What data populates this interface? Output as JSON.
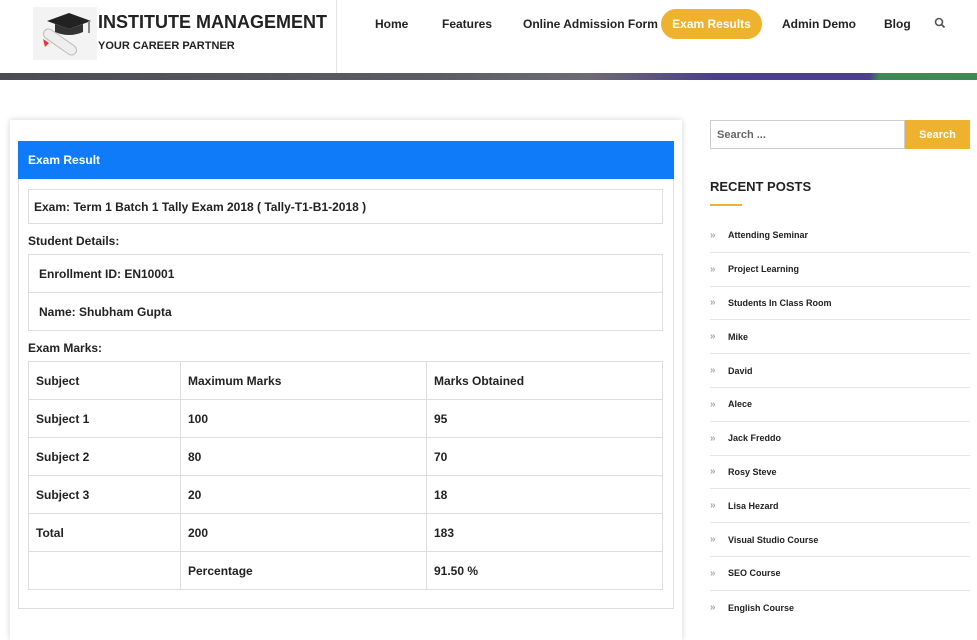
{
  "header": {
    "brand": "INSTITUTE MANAGEMENT",
    "tagline": "YOUR CAREER PARTNER",
    "nav": [
      "Home",
      "Features",
      "Online Admission Form",
      "Exam Results",
      "Admin Demo",
      "Blog"
    ],
    "active": "Exam Results"
  },
  "result": {
    "title": "Exam Result",
    "exam": "Exam: Term 1 Batch 1 Tally Exam 2018 ( Tally-T1-B1-2018 )",
    "student_label": "Student Details:",
    "enrollment": "Enrollment ID: EN10001",
    "name": "Name: Shubham Gupta",
    "marks_label": "Exam Marks:",
    "columns": [
      "Subject",
      "Maximum Marks",
      "Marks Obtained"
    ],
    "rows": [
      [
        "Subject 1",
        "100",
        "95"
      ],
      [
        "Subject 2",
        "80",
        "70"
      ],
      [
        "Subject 3",
        "20",
        "18"
      ],
      [
        "Total",
        "200",
        "183"
      ],
      [
        "",
        "Percentage",
        "91.50 %"
      ]
    ]
  },
  "sidebar": {
    "search_placeholder": "Search ...",
    "search_button": "Search",
    "recent_title": "RECENT POSTS",
    "posts": [
      "Attending Seminar",
      "Project Learning",
      "Students In Class Room",
      "Mike",
      "David",
      "Alece",
      "Jack Freddo",
      "Rosy Steve",
      "Lisa Hezard",
      "Visual Studio Course",
      "SEO Course",
      "English Course"
    ]
  },
  "colors": {
    "accent": "#eeb22e",
    "panel": "#0f7bf9"
  }
}
